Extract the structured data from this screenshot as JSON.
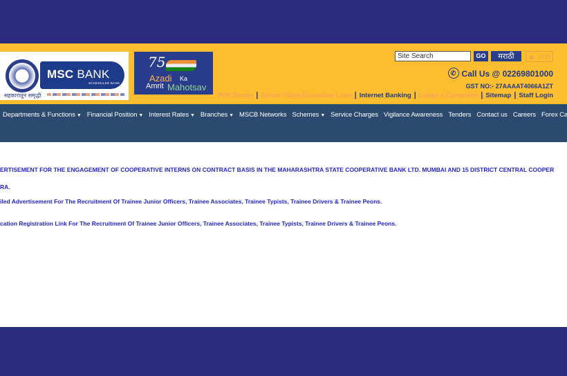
{
  "logo": {
    "bank_name_bold": "MSC",
    "bank_name_light": "BANK",
    "bank_sub": "SCHEDULED BANK",
    "tagline": "सहकारातून समृद्धी"
  },
  "azadi": {
    "number": "75",
    "line1": "Azadi",
    "ka": "Ka",
    "line2": "Amrit",
    "line3": "Mahotsav"
  },
  "header": {
    "search_placeholder": "Site Search",
    "go_label": "GO",
    "marathi_label": "मराठी",
    "atm_label": "ATM",
    "call_label": "Call Us @ 02269801000",
    "gst_label": "GST NO:- 27AAAAT4066A1ZT",
    "links": [
      {
        "label": "PDF Bonds",
        "faded": true
      },
      {
        "label": "Shram Vidya Education Loan",
        "faded": true
      },
      {
        "label": "Internet Banking",
        "faded": false
      },
      {
        "label": "Lodge a Complaint",
        "faded": true
      },
      {
        "label": "Sitemap",
        "faded": false
      },
      {
        "label": "Staff Login",
        "faded": false
      }
    ]
  },
  "nav": {
    "items": [
      {
        "label": "Departments & Functions",
        "dropdown": true
      },
      {
        "label": "Financial Position",
        "dropdown": true
      },
      {
        "label": "Interest Rates",
        "dropdown": true
      },
      {
        "label": "Branches",
        "dropdown": true
      },
      {
        "label": "MSCB Networks",
        "dropdown": false
      },
      {
        "label": "Schemes",
        "dropdown": true
      },
      {
        "label": "Service Charges",
        "dropdown": false
      },
      {
        "label": "Vigilance Awareness",
        "dropdown": false
      },
      {
        "label": "Tenders",
        "dropdown": false
      },
      {
        "label": "Contact us",
        "dropdown": false
      },
      {
        "label": "Careers",
        "dropdown": false
      },
      {
        "label": "Forex Card",
        "dropdown": false
      }
    ]
  },
  "notices": [
    "ERTISEMENT FOR THE ENGAGEMENT OF COOPERATIVE INTERNS ON CONTRACT BASIS IN THE MAHARASHTRA STATE COOPERATIVE BANK LTD. MUMBAI AND 15 DISTRICT CENTRAL COOPER",
    "RA.",
    "iled Advertisement For The Recruitment Of Trainee Junior Officers, Trainee Associates, Trainee Typists, Trainee Drivers & Trainee Peons.",
    "cation Registration Link For The Recruitment Of Trainee Junior Officers, Trainee Associates, Trainee Typists, Trainee Drivers & Trainee Peons."
  ]
}
